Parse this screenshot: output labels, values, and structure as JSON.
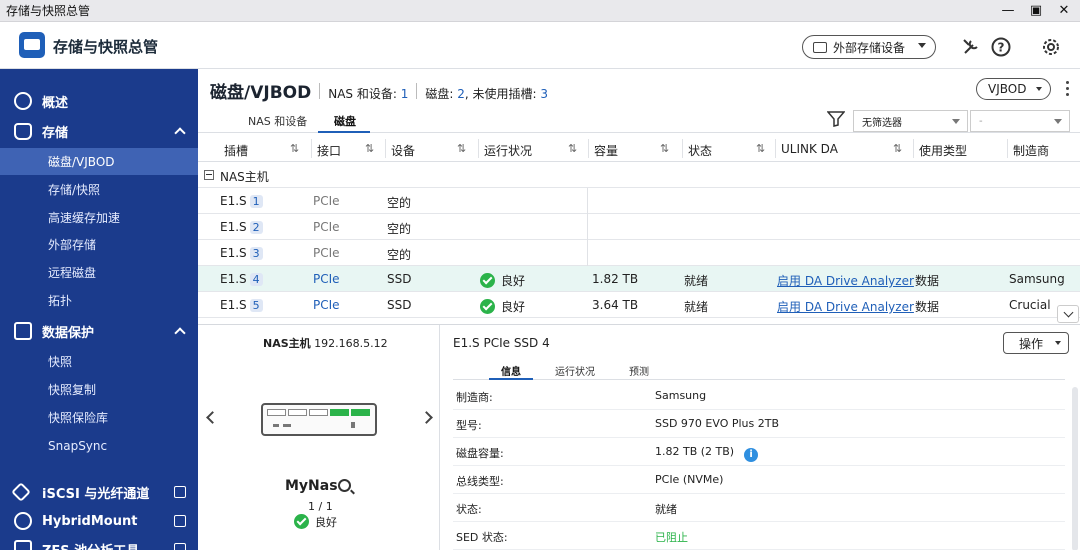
{
  "window": {
    "title": "存储与快照总管"
  },
  "header": {
    "app_title": "存储与快照总管",
    "external_button": "外部存储设备"
  },
  "sidebar": {
    "groups": [
      {
        "label": "概述"
      },
      {
        "label": "存储",
        "items": [
          "磁盘/VJBOD",
          "存储/快照",
          "高速缓存加速",
          "外部存储",
          "远程磁盘",
          "拓扑"
        ]
      },
      {
        "label": "数据保护",
        "items": [
          "快照",
          "快照复制",
          "快照保险库",
          "SnapSync"
        ]
      },
      {
        "label": "iSCSI 与光纤通道"
      },
      {
        "label": "HybridMount"
      },
      {
        "label": "ZFS 池分析工具"
      }
    ]
  },
  "main": {
    "title": "磁盘/VJBOD",
    "summary": {
      "nas_label": "NAS 和设备:",
      "nas_count": "1",
      "disk_label": "磁盘:",
      "disk_count": "2",
      "unused_label": ", 未使用插槽:",
      "unused_count": "3"
    },
    "vjbod_button": "VJBOD",
    "tabs": [
      "NAS 和设备",
      "磁盘"
    ],
    "filter": {
      "value": "无筛选器",
      "second": "-"
    },
    "columns": [
      "插槽",
      "接口",
      "设备",
      "运行状况",
      "容量",
      "状态",
      "ULINK DA",
      "使用类型",
      "制造商"
    ],
    "group_label": "NAS主机",
    "rows": [
      {
        "slot": "E1.S",
        "num": "1",
        "iface": "PCIe",
        "device": "空的",
        "health": "",
        "capacity": "",
        "status": "",
        "ulink": "",
        "usage": "",
        "vendor": ""
      },
      {
        "slot": "E1.S",
        "num": "2",
        "iface": "PCIe",
        "device": "空的",
        "health": "",
        "capacity": "",
        "status": "",
        "ulink": "",
        "usage": "",
        "vendor": ""
      },
      {
        "slot": "E1.S",
        "num": "3",
        "iface": "PCIe",
        "device": "空的",
        "health": "",
        "capacity": "",
        "status": "",
        "ulink": "",
        "usage": "",
        "vendor": ""
      },
      {
        "slot": "E1.S",
        "num": "4",
        "iface": "PCIe",
        "device": "SSD",
        "health": "良好",
        "capacity": "1.82 TB",
        "status": "就绪",
        "ulink": "启用 DA Drive Analyzer",
        "usage": "数据",
        "vendor": "Samsung"
      },
      {
        "slot": "E1.S",
        "num": "5",
        "iface": "PCIe",
        "device": "SSD",
        "health": "良好",
        "capacity": "3.64 TB",
        "status": "就绪",
        "ulink": "启用 DA Drive Analyzer",
        "usage": "数据",
        "vendor": "Crucial"
      }
    ]
  },
  "detail": {
    "nas_label": "NAS主机",
    "nas_ip": "192.168.5.12",
    "device_name": "MyNas",
    "device_count": "1 / 1",
    "device_status": "良好",
    "disk_title": "E1.S PCIe SSD 4",
    "ops_button": "操作",
    "tabs": [
      "信息",
      "运行状况",
      "预测"
    ],
    "props": [
      {
        "k": "制造商:",
        "v": "Samsung"
      },
      {
        "k": "型号:",
        "v": "SSD 970 EVO Plus 2TB"
      },
      {
        "k": "磁盘容量:",
        "v": "1.82 TB (2 TB)"
      },
      {
        "k": "总线类型:",
        "v": "PCIe (NVMe)"
      },
      {
        "k": "状态:",
        "v": "就绪"
      },
      {
        "k": "SED 状态:",
        "v": "已阻止"
      }
    ]
  },
  "colors": {
    "sidebar": "#1b3b8c",
    "active": "#3f63b4",
    "accent": "#1f5fb8",
    "ok": "#2bb34a"
  }
}
